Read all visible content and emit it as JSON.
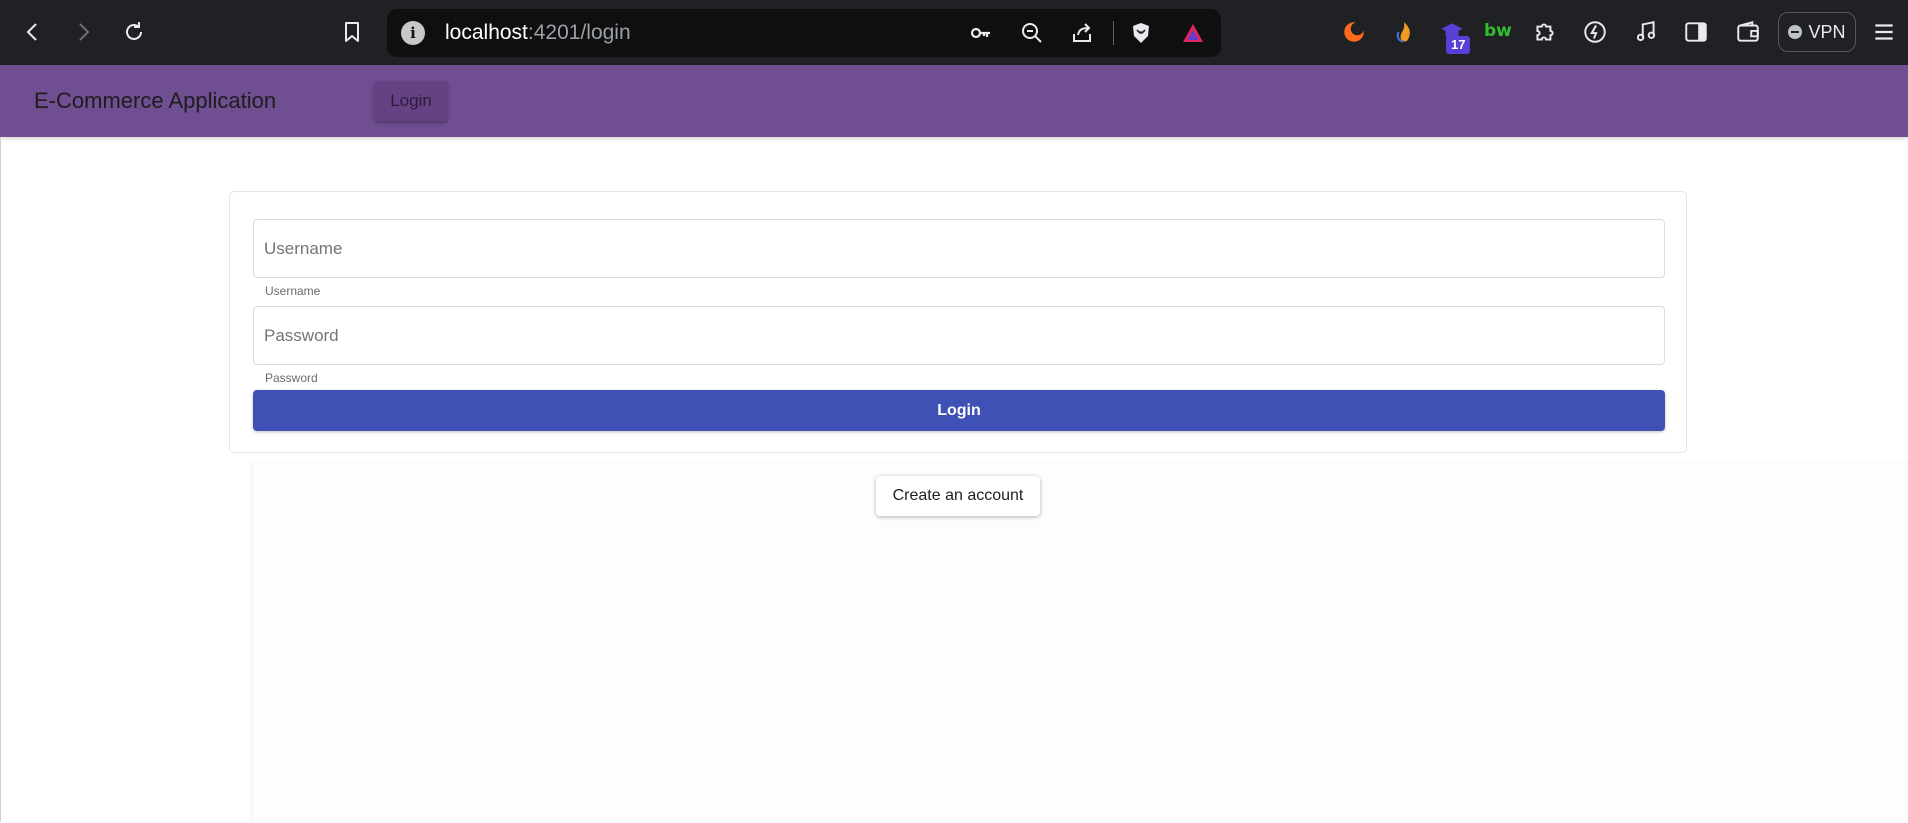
{
  "browser": {
    "url_host": "localhost",
    "url_path": ":4201/login",
    "extension_badge": "17",
    "bw_label": "bw",
    "vpn_label": "VPN"
  },
  "app": {
    "title": "E-Commerce Application",
    "nav_login_label": "Login"
  },
  "login_form": {
    "username_placeholder": "Username",
    "username_hint": "Username",
    "password_placeholder": "Password",
    "password_hint": "Password",
    "submit_label": "Login"
  },
  "create_account_label": "Create an account",
  "colors": {
    "toolbar": "#6f4e92",
    "primary_button": "#3f51b5",
    "browser_chrome": "#202124"
  }
}
